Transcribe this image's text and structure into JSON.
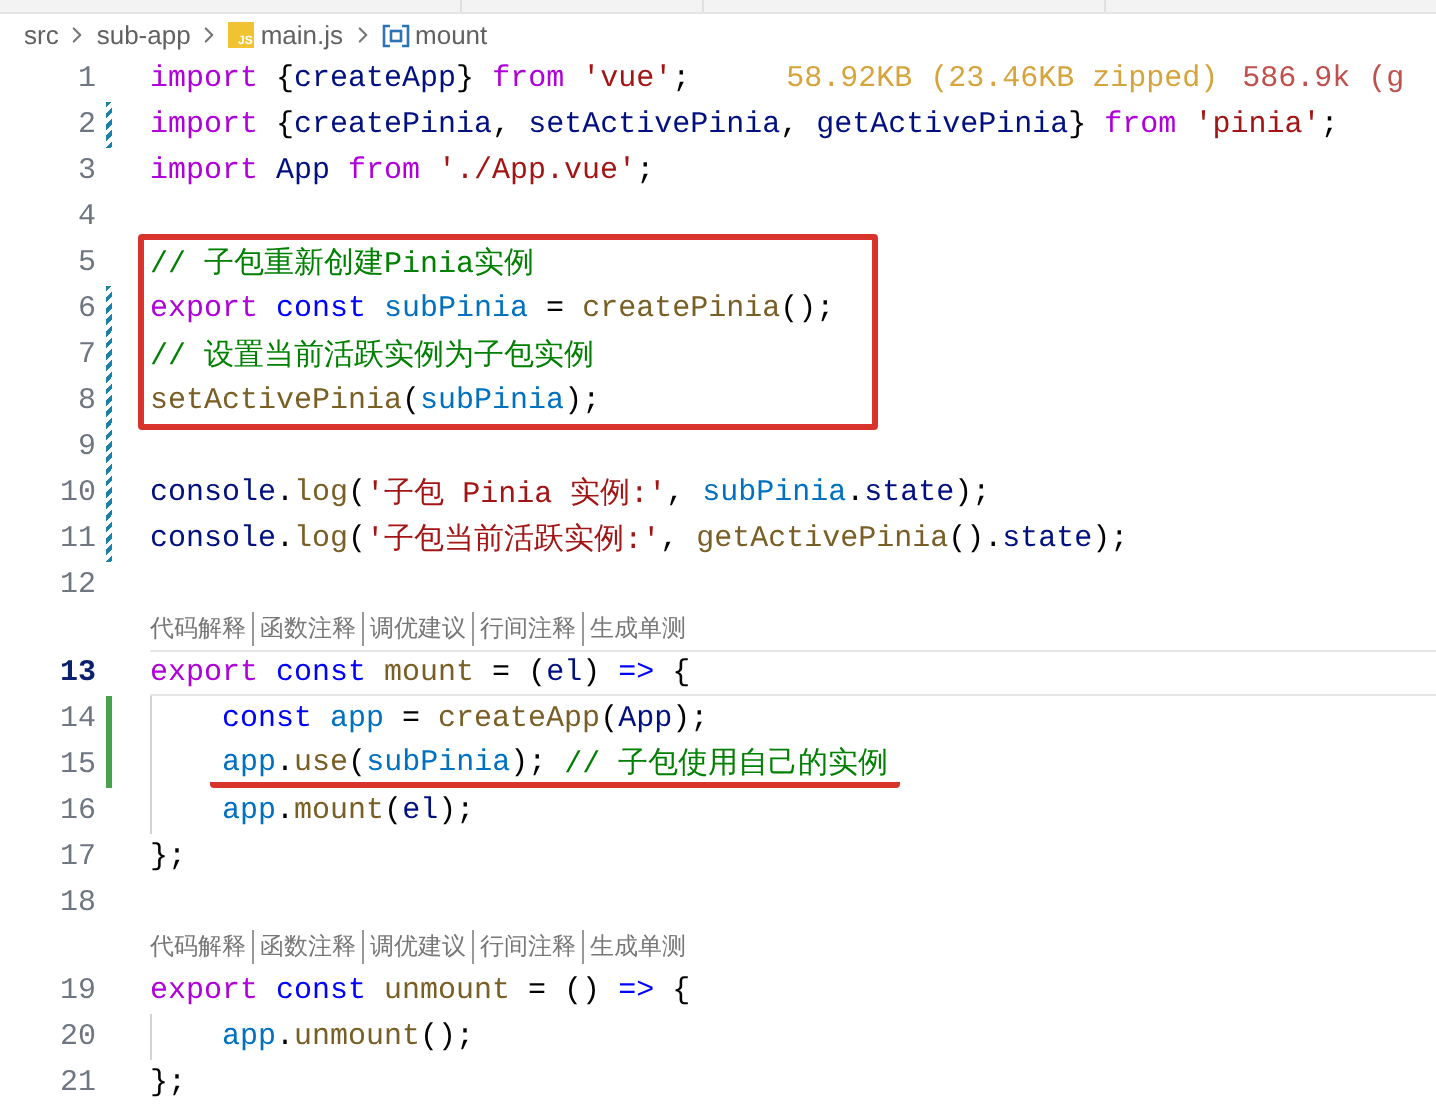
{
  "breadcrumb": [
    {
      "kind": "folder",
      "label": "src"
    },
    {
      "kind": "folder",
      "label": "sub-app"
    },
    {
      "kind": "file",
      "badge": "JS",
      "label": "main.js"
    },
    {
      "kind": "symbol",
      "label": "mount"
    }
  ],
  "rows": [
    {
      "kind": "code",
      "number": "1",
      "modified": false,
      "added": false,
      "current": false,
      "boxed": false,
      "underlined": false,
      "indented": false,
      "tokens": [
        {
          "kind": "keyword",
          "text": "import"
        },
        {
          "kind": "punct",
          "text": " {"
        },
        {
          "kind": "variable",
          "text": "createApp"
        },
        {
          "kind": "punct",
          "text": "} "
        },
        {
          "kind": "keyword",
          "text": "from"
        },
        {
          "kind": "string",
          "text": "'vue'",
          "spaced": true
        },
        {
          "kind": "punct",
          "text": ";"
        },
        {
          "kind": "size",
          "text": "58.92KB (23.46KB zipped)"
        },
        {
          "kind": "size-alert",
          "text": "586.9k (g"
        }
      ]
    },
    {
      "kind": "code",
      "number": "2",
      "modified": true,
      "added": false,
      "current": false,
      "boxed": false,
      "underlined": false,
      "indented": false,
      "tokens": [
        {
          "kind": "keyword",
          "text": "import"
        },
        {
          "kind": "punct",
          "text": " {"
        },
        {
          "kind": "variable",
          "text": "createPinia"
        },
        {
          "kind": "punct",
          "text": ", "
        },
        {
          "kind": "variable",
          "text": "setActivePinia"
        },
        {
          "kind": "punct",
          "text": ", "
        },
        {
          "kind": "variable",
          "text": "getActivePinia"
        },
        {
          "kind": "punct",
          "text": "} "
        },
        {
          "kind": "keyword",
          "text": "from"
        },
        {
          "kind": "string",
          "text": "'pinia'",
          "spaced": true
        },
        {
          "kind": "punct",
          "text": ";"
        }
      ]
    },
    {
      "kind": "code",
      "number": "3",
      "modified": false,
      "added": false,
      "current": false,
      "boxed": false,
      "underlined": false,
      "indented": false,
      "tokens": [
        {
          "kind": "keyword",
          "text": "import"
        },
        {
          "kind": "variable",
          "text": "App",
          "spaced": true
        },
        {
          "kind": "keyword",
          "text": "from",
          "spaced": true
        },
        {
          "kind": "string",
          "text": "'./App.vue'",
          "spaced": true
        },
        {
          "kind": "punct",
          "text": ";"
        }
      ]
    },
    {
      "kind": "code",
      "number": "4",
      "modified": false,
      "added": false,
      "current": false,
      "boxed": false,
      "underlined": false,
      "indented": false
    },
    {
      "kind": "code",
      "number": "5",
      "modified": false,
      "added": false,
      "current": false,
      "boxed": true,
      "underlined": false,
      "indented": false,
      "tokens": [
        {
          "kind": "comment",
          "text": "// 子包重新创建Pinia实例"
        }
      ]
    },
    {
      "kind": "code",
      "number": "6",
      "modified": true,
      "added": false,
      "current": false,
      "boxed": true,
      "underlined": false,
      "indented": false,
      "tokens": [
        {
          "kind": "keyword",
          "text": "export"
        },
        {
          "kind": "storage",
          "text": "const",
          "spaced": true
        },
        {
          "kind": "constant",
          "text": "subPinia",
          "spaced": true
        },
        {
          "kind": "punct",
          "text": " = "
        },
        {
          "kind": "function",
          "text": "createPinia"
        },
        {
          "kind": "punct",
          "text": "();"
        }
      ]
    },
    {
      "kind": "code",
      "number": "7",
      "modified": true,
      "added": false,
      "current": false,
      "boxed": true,
      "underlined": false,
      "indented": false,
      "tokens": [
        {
          "kind": "comment",
          "text": "// 设置当前活跃实例为子包实例"
        }
      ]
    },
    {
      "kind": "code",
      "number": "8",
      "modified": true,
      "added": false,
      "current": false,
      "boxed": true,
      "underlined": false,
      "indented": false,
      "tokens": [
        {
          "kind": "function",
          "text": "setActivePinia"
        },
        {
          "kind": "punct",
          "text": "("
        },
        {
          "kind": "constant",
          "text": "subPinia"
        },
        {
          "kind": "punct",
          "text": ");"
        }
      ]
    },
    {
      "kind": "code",
      "number": "9",
      "modified": true,
      "added": false,
      "current": false,
      "boxed": false,
      "underlined": false,
      "indented": false
    },
    {
      "kind": "code",
      "number": "10",
      "modified": true,
      "added": false,
      "current": false,
      "boxed": false,
      "underlined": false,
      "indented": false,
      "tokens": [
        {
          "kind": "variable",
          "text": "console"
        },
        {
          "kind": "punct",
          "text": "."
        },
        {
          "kind": "function",
          "text": "log"
        },
        {
          "kind": "punct",
          "text": "("
        },
        {
          "kind": "string",
          "text": "'子包 Pinia 实例:'"
        },
        {
          "kind": "punct",
          "text": ", "
        },
        {
          "kind": "constant",
          "text": "subPinia"
        },
        {
          "kind": "punct",
          "text": "."
        },
        {
          "kind": "variable",
          "text": "state"
        },
        {
          "kind": "punct",
          "text": ");"
        }
      ]
    },
    {
      "kind": "code",
      "number": "11",
      "modified": true,
      "added": false,
      "current": false,
      "boxed": false,
      "underlined": false,
      "indented": false,
      "tokens": [
        {
          "kind": "variable",
          "text": "console"
        },
        {
          "kind": "punct",
          "text": "."
        },
        {
          "kind": "function",
          "text": "log"
        },
        {
          "kind": "punct",
          "text": "("
        },
        {
          "kind": "string",
          "text": "'子包当前活跃实例:'"
        },
        {
          "kind": "punct",
          "text": ", "
        },
        {
          "kind": "function",
          "text": "getActivePinia"
        },
        {
          "kind": "punct",
          "text": "()."
        },
        {
          "kind": "variable",
          "text": "state"
        },
        {
          "kind": "punct",
          "text": ");"
        }
      ]
    },
    {
      "kind": "code",
      "number": "12",
      "modified": false,
      "added": false,
      "current": false,
      "boxed": false,
      "underlined": false,
      "indented": false
    },
    {
      "kind": "lens",
      "actions": [
        "代码解释",
        "函数注释",
        "调优建议",
        "行间注释",
        "生成单测"
      ]
    },
    {
      "kind": "code",
      "number": "13",
      "modified": false,
      "added": false,
      "current": true,
      "boxed": false,
      "underlined": false,
      "indented": false,
      "tokens": [
        {
          "kind": "keyword",
          "text": "export"
        },
        {
          "kind": "storage",
          "text": "const",
          "spaced": true
        },
        {
          "kind": "function",
          "text": "mount",
          "spaced": true
        },
        {
          "kind": "punct",
          "text": " = ("
        },
        {
          "kind": "variable",
          "text": "el"
        },
        {
          "kind": "punct",
          "text": ") "
        },
        {
          "kind": "storage",
          "text": "=>"
        },
        {
          "kind": "punct",
          "text": " {"
        }
      ]
    },
    {
      "kind": "code",
      "number": "14",
      "modified": false,
      "added": true,
      "current": false,
      "boxed": false,
      "underlined": false,
      "indented": true,
      "tokens": [
        {
          "kind": "storage",
          "text": "const"
        },
        {
          "kind": "constant",
          "text": "app",
          "spaced": true
        },
        {
          "kind": "punct",
          "text": " = "
        },
        {
          "kind": "function",
          "text": "createApp"
        },
        {
          "kind": "punct",
          "text": "("
        },
        {
          "kind": "variable",
          "text": "App"
        },
        {
          "kind": "punct",
          "text": ");"
        }
      ]
    },
    {
      "kind": "code",
      "number": "15",
      "modified": false,
      "added": true,
      "current": false,
      "boxed": false,
      "underlined": true,
      "indented": true,
      "tokens": [
        {
          "kind": "constant",
          "text": "app"
        },
        {
          "kind": "punct",
          "text": "."
        },
        {
          "kind": "function",
          "text": "use"
        },
        {
          "kind": "punct",
          "text": "("
        },
        {
          "kind": "constant",
          "text": "subPinia"
        },
        {
          "kind": "punct",
          "text": "); "
        },
        {
          "kind": "comment",
          "text": "// 子包使用自己的实例"
        }
      ]
    },
    {
      "kind": "code",
      "number": "16",
      "modified": false,
      "added": false,
      "current": false,
      "boxed": false,
      "underlined": false,
      "indented": true,
      "tokens": [
        {
          "kind": "constant",
          "text": "app"
        },
        {
          "kind": "punct",
          "text": "."
        },
        {
          "kind": "function",
          "text": "mount"
        },
        {
          "kind": "punct",
          "text": "("
        },
        {
          "kind": "variable",
          "text": "el"
        },
        {
          "kind": "punct",
          "text": ");"
        }
      ]
    },
    {
      "kind": "code",
      "number": "17",
      "modified": false,
      "added": false,
      "current": false,
      "boxed": false,
      "underlined": false,
      "indented": false,
      "tokens": [
        {
          "kind": "punct",
          "text": "};"
        }
      ]
    },
    {
      "kind": "code",
      "number": "18",
      "modified": false,
      "added": false,
      "current": false,
      "boxed": false,
      "underlined": false,
      "indented": false
    },
    {
      "kind": "lens",
      "actions": [
        "代码解释",
        "函数注释",
        "调优建议",
        "行间注释",
        "生成单测"
      ]
    },
    {
      "kind": "code",
      "number": "19",
      "modified": false,
      "added": false,
      "current": false,
      "boxed": false,
      "underlined": false,
      "indented": false,
      "tokens": [
        {
          "kind": "keyword",
          "text": "export"
        },
        {
          "kind": "storage",
          "text": "const",
          "spaced": true
        },
        {
          "kind": "function",
          "text": "unmount",
          "spaced": true
        },
        {
          "kind": "punct",
          "text": " = () "
        },
        {
          "kind": "storage",
          "text": "=>"
        },
        {
          "kind": "punct",
          "text": " {"
        }
      ]
    },
    {
      "kind": "code",
      "number": "20",
      "modified": false,
      "added": false,
      "current": false,
      "boxed": false,
      "underlined": false,
      "indented": true,
      "tokens": [
        {
          "kind": "constant",
          "text": "app"
        },
        {
          "kind": "punct",
          "text": "."
        },
        {
          "kind": "function",
          "text": "unmount"
        },
        {
          "kind": "punct",
          "text": "();"
        }
      ]
    },
    {
      "kind": "code",
      "number": "21",
      "modified": false,
      "added": false,
      "current": false,
      "boxed": false,
      "underlined": false,
      "indented": false,
      "tokens": [
        {
          "kind": "punct",
          "text": "};"
        }
      ]
    }
  ]
}
